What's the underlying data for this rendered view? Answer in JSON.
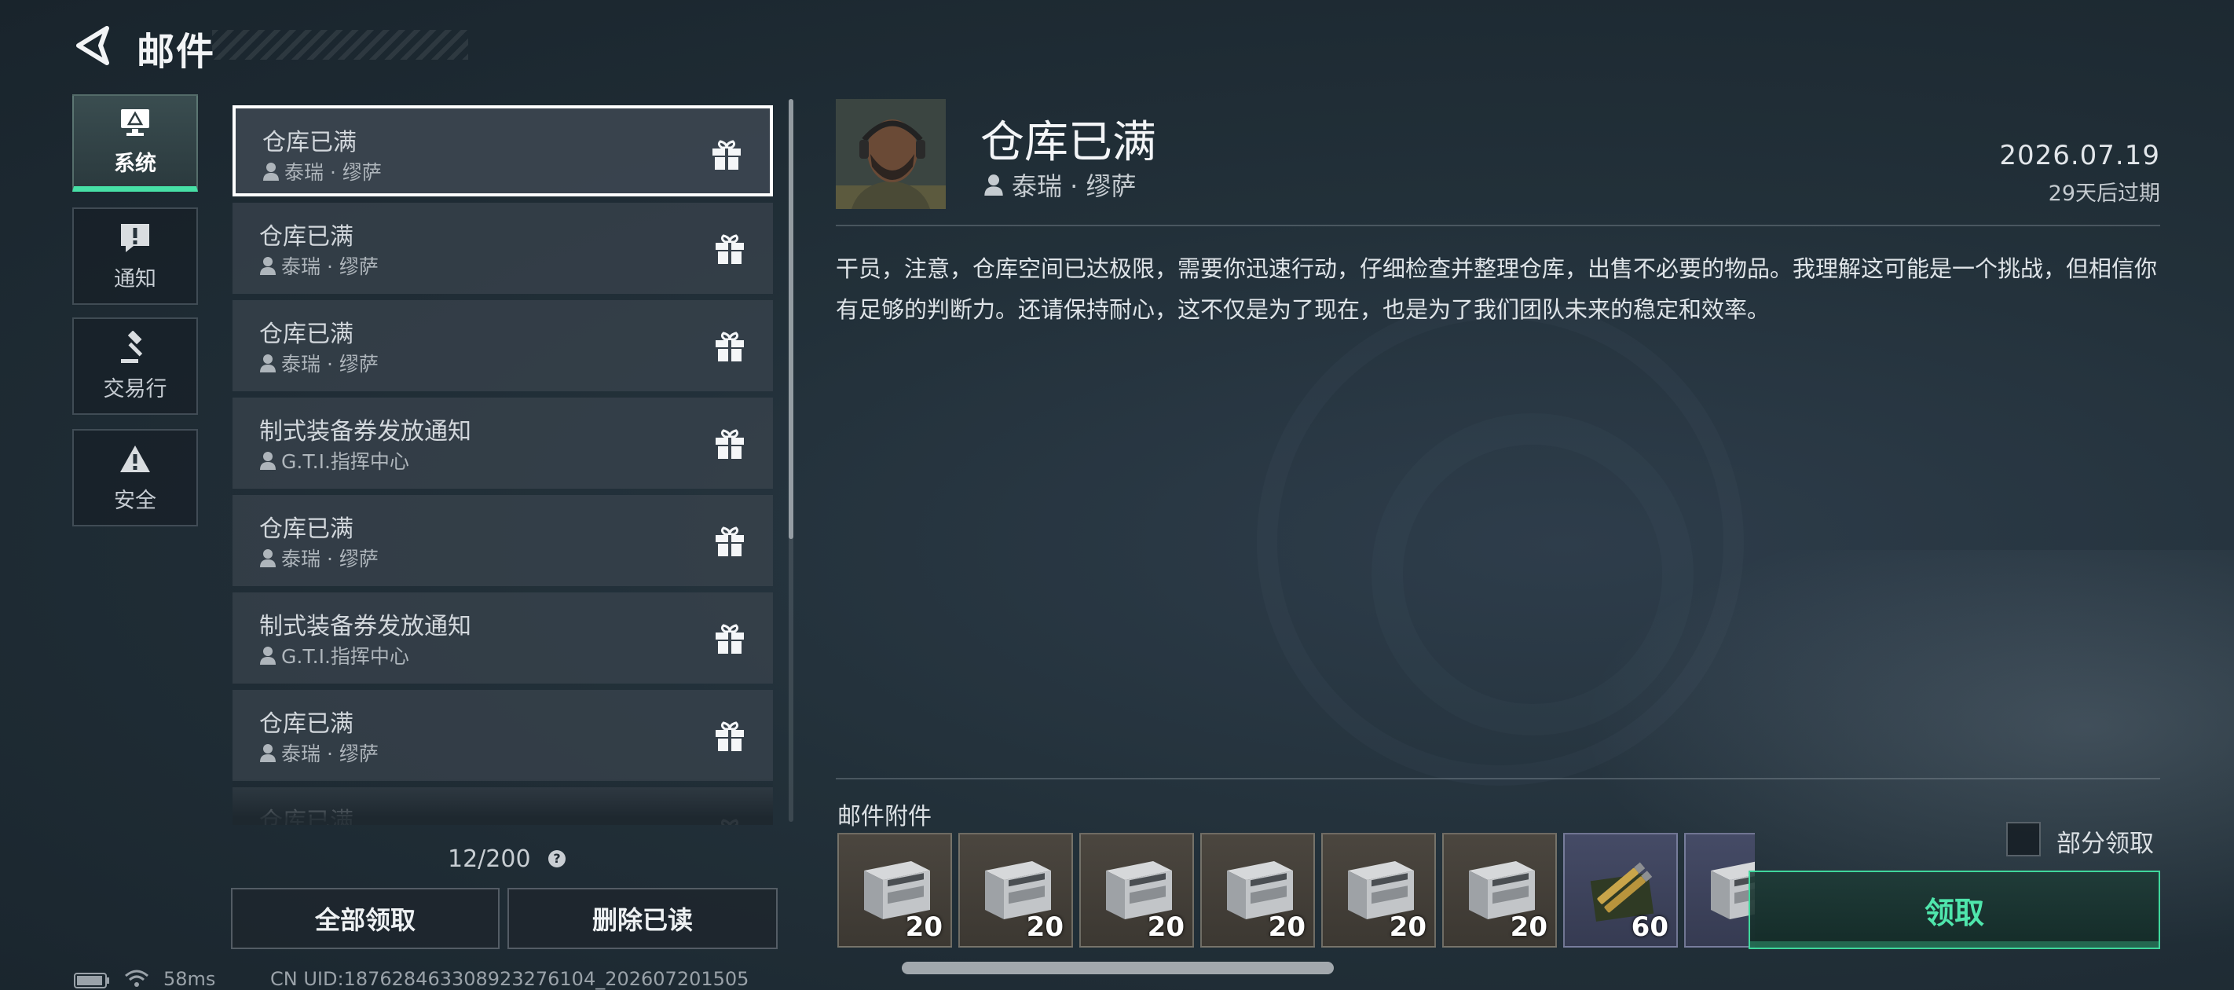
{
  "header": {
    "title": "邮件",
    "back_icon": "back-arrow-icon"
  },
  "nav": [
    {
      "label": "系统",
      "icon": "monitor-icon",
      "active": true
    },
    {
      "label": "通知",
      "icon": "exclamation-icon",
      "active": false
    },
    {
      "label": "交易行",
      "icon": "gavel-icon",
      "active": false
    },
    {
      "label": "安全",
      "icon": "warning-triangle-icon",
      "active": false
    }
  ],
  "mail_list": [
    {
      "title": "仓库已满",
      "sender": "泰瑞 · 缪萨",
      "selected": true,
      "icon": "gift-icon"
    },
    {
      "title": "仓库已满",
      "sender": "泰瑞 · 缪萨",
      "selected": false,
      "icon": "gift-icon"
    },
    {
      "title": "仓库已满",
      "sender": "泰瑞 · 缪萨",
      "selected": false,
      "icon": "gift-icon"
    },
    {
      "title": "制式装备券发放通知",
      "sender": "G.T.I.指挥中心",
      "selected": false,
      "icon": "gift-icon"
    },
    {
      "title": "仓库已满",
      "sender": "泰瑞 · 缪萨",
      "selected": false,
      "icon": "gift-icon"
    },
    {
      "title": "制式装备券发放通知",
      "sender": "G.T.I.指挥中心",
      "selected": false,
      "icon": "gift-icon"
    },
    {
      "title": "仓库已满",
      "sender": "泰瑞 · 缪萨",
      "selected": false,
      "icon": "gift-icon"
    },
    {
      "title": "仓库已满",
      "sender": "",
      "selected": false,
      "icon": "gift-icon"
    }
  ],
  "mail_count": "12/200",
  "help_label": "?",
  "buttons": {
    "claim_all": "全部领取",
    "delete_read": "删除已读"
  },
  "detail": {
    "title": "仓库已满",
    "sender": "泰瑞 · 缪萨",
    "date": "2026.07.19",
    "expiry": "29天后过期",
    "body": "干员，注意，仓库空间已达极限，需要你迅速行动，仔细检查并整理仓库，出售不必要的物品。我理解这可能是一个挑战，但相信你有足够的判断力。还请保持耐心，这不仅是为了现在，也是为了我们团队未来的稳定和效率。"
  },
  "attachments": {
    "label": "邮件附件",
    "items": [
      {
        "count": "20",
        "icon": "ammo-box-icon",
        "rarity": "gray"
      },
      {
        "count": "20",
        "icon": "ammo-box-icon",
        "rarity": "gray"
      },
      {
        "count": "20",
        "icon": "ammo-box-icon",
        "rarity": "gray"
      },
      {
        "count": "20",
        "icon": "ammo-box-icon",
        "rarity": "gray"
      },
      {
        "count": "20",
        "icon": "ammo-box-icon",
        "rarity": "gray"
      },
      {
        "count": "20",
        "icon": "ammo-box-icon",
        "rarity": "gray"
      },
      {
        "count": "60",
        "icon": "ammo-rounds-icon",
        "rarity": "blue"
      },
      {
        "count": "",
        "icon": "ammo-box-icon",
        "rarity": "blue"
      }
    ],
    "partial_claim_label": "部分领取",
    "claim_label": "领取"
  },
  "colors": {
    "accent_green": "#47e0a6",
    "claim_text": "#4fe6ac",
    "background": "#1f2b33"
  },
  "status_bar": {
    "ping": "58ms",
    "uid": "CN UID:18762846330892327610​4_202607201505"
  }
}
